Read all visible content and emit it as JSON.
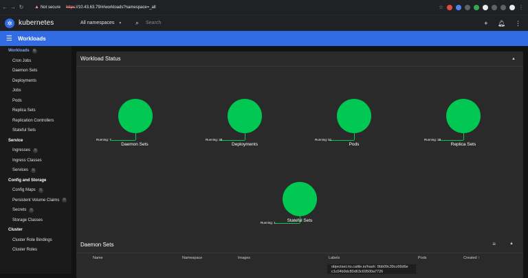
{
  "browser": {
    "security_warning": "Not secure",
    "url_scheme": "https",
    "url_rest": "://10.43.63.79/#/workloads?namespace=_all"
  },
  "app": {
    "name": "kubernetes",
    "namespace_selected": "All namespaces",
    "search_placeholder": "Search"
  },
  "page": {
    "title": "Workloads"
  },
  "sidebar": {
    "items": [
      {
        "label": "Workloads",
        "type": "active",
        "pin": "N"
      },
      {
        "label": "Cron Jobs",
        "type": "item"
      },
      {
        "label": "Daemon Sets",
        "type": "item"
      },
      {
        "label": "Deployments",
        "type": "item"
      },
      {
        "label": "Jobs",
        "type": "item"
      },
      {
        "label": "Pods",
        "type": "item"
      },
      {
        "label": "Replica Sets",
        "type": "item"
      },
      {
        "label": "Replication Controllers",
        "type": "item"
      },
      {
        "label": "Stateful Sets",
        "type": "item"
      },
      {
        "label": "Service",
        "type": "section"
      },
      {
        "label": "Ingresses",
        "type": "item",
        "pin": "N"
      },
      {
        "label": "Ingress Classes",
        "type": "item"
      },
      {
        "label": "Services",
        "type": "item",
        "pin": "N"
      },
      {
        "label": "Config and Storage",
        "type": "section"
      },
      {
        "label": "Config Maps",
        "type": "item",
        "pin": "N"
      },
      {
        "label": "Persistent Volume Claims",
        "type": "item",
        "pin": "N"
      },
      {
        "label": "Secrets",
        "type": "item",
        "pin": "N"
      },
      {
        "label": "Storage Classes",
        "type": "item"
      },
      {
        "label": "Cluster",
        "type": "section"
      },
      {
        "label": "Cluster Role Bindings",
        "type": "item"
      },
      {
        "label": "Cluster Roles",
        "type": "item"
      }
    ]
  },
  "workload_status": {
    "title": "Workload Status",
    "charts": [
      {
        "label": "Daemon Sets",
        "running": "Running: 7"
      },
      {
        "label": "Deployments",
        "running": "Running: 29"
      },
      {
        "label": "Pods",
        "running": "Running: 51"
      },
      {
        "label": "Replica Sets",
        "running": "Running: 29"
      },
      {
        "label": "Stateful Sets",
        "running": "Running: 1"
      }
    ],
    "color": "#00c853"
  },
  "daemon_sets": {
    "title": "Daemon Sets",
    "columns": [
      "Name",
      "Namespace",
      "Images",
      "Labels",
      "Pods",
      "Created ↑"
    ],
    "tooltip": "objectset.rio.cattle.io/hash: 9bb09c39cc66d6e c1c04b9dc80d63c69500a7726"
  }
}
